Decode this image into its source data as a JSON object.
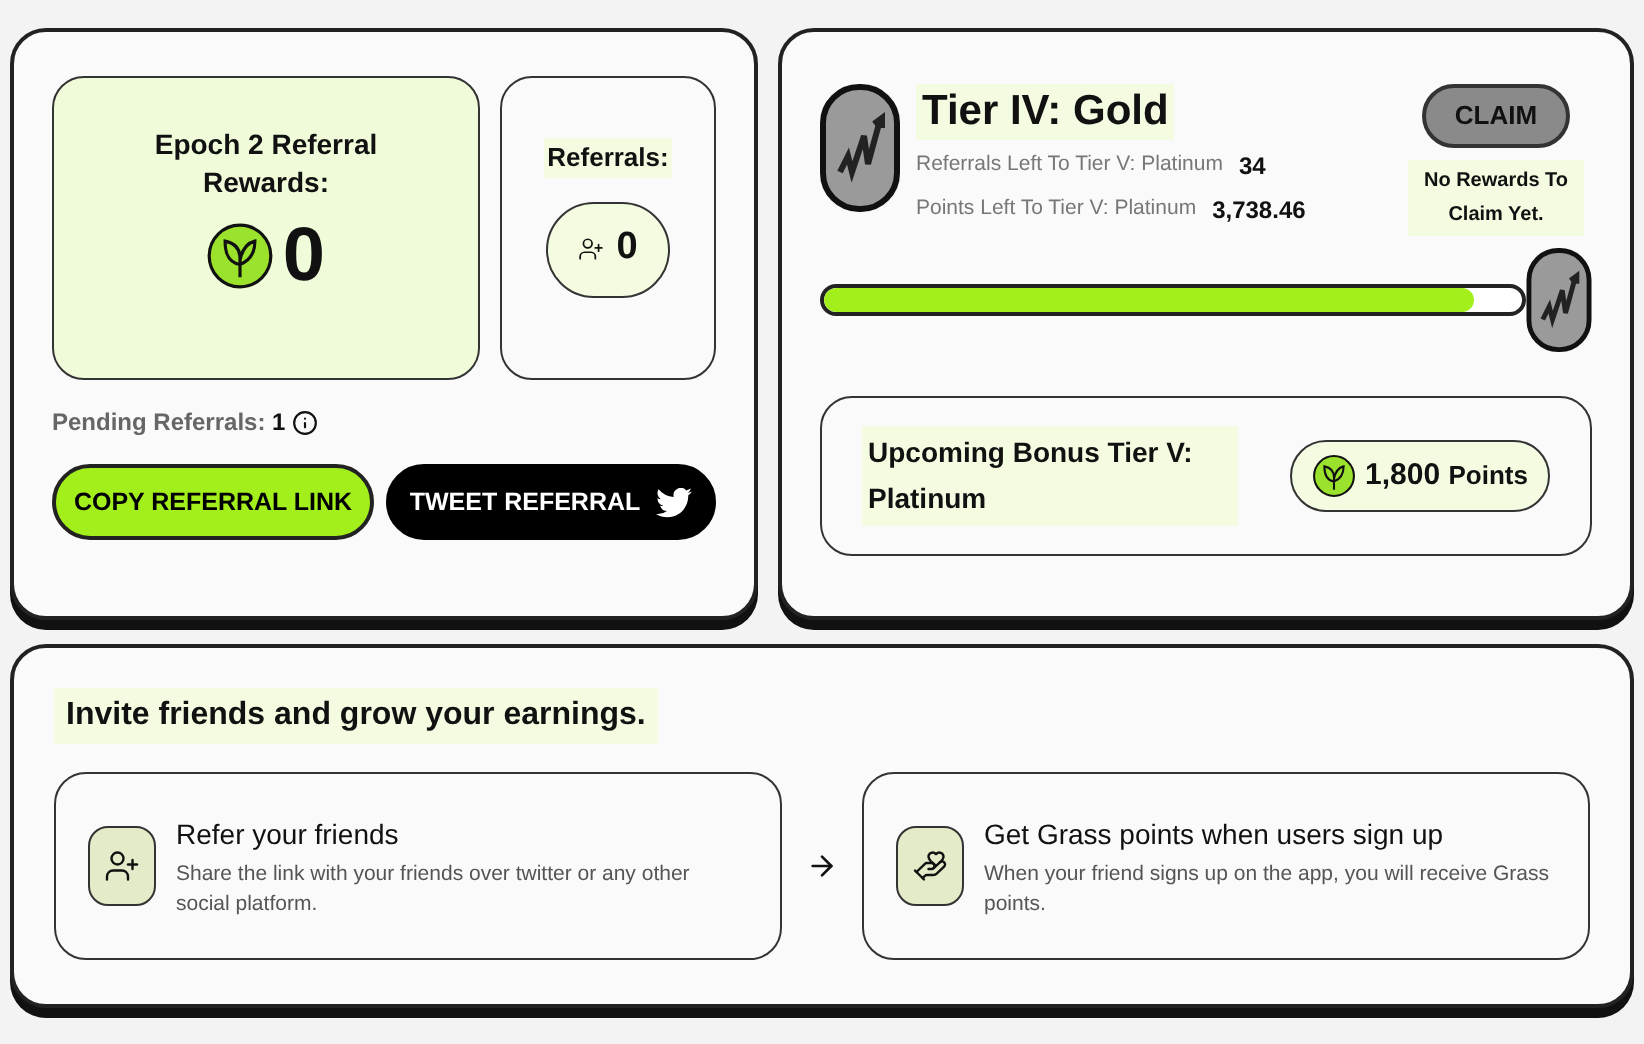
{
  "rewards": {
    "title": "Epoch 2 Referral Rewards:",
    "amount": "0"
  },
  "referrals": {
    "title": "Referrals:",
    "count": "0"
  },
  "pending": {
    "label": "Pending Referrals:",
    "count": "1"
  },
  "buttons": [
    {
      "kind": "primary",
      "label": "COPY REFERRAL LINK"
    },
    {
      "kind": "dark",
      "label": "TWEET REFERRAL"
    }
  ],
  "tier": {
    "title": "Tier IV: Gold",
    "stats": [
      {
        "label": "Referrals Left To Tier V: Platinum",
        "value": "34"
      },
      {
        "label": "Points Left To Tier V: Platinum",
        "value": "3,738.46"
      }
    ],
    "claim": {
      "label": "CLAIM",
      "disabled": true
    },
    "claim_note": "No Rewards To Claim Yet.",
    "level": 0.93,
    "bonus": {
      "label": "Upcoming Bonus Tier V: Platinum",
      "amount": "1,800",
      "unit": "Points"
    }
  },
  "invite": {
    "title": "Invite friends and grow your earnings.",
    "steps": [
      {
        "kind": "refer",
        "title": "Refer your friends",
        "text": "Share the link with your friends over twitter or any other social platform."
      },
      {
        "kind": "earn",
        "title": "Get Grass points when users sign up",
        "text": "When your friend signs up on the app, you will receive Grass points."
      }
    ]
  }
}
